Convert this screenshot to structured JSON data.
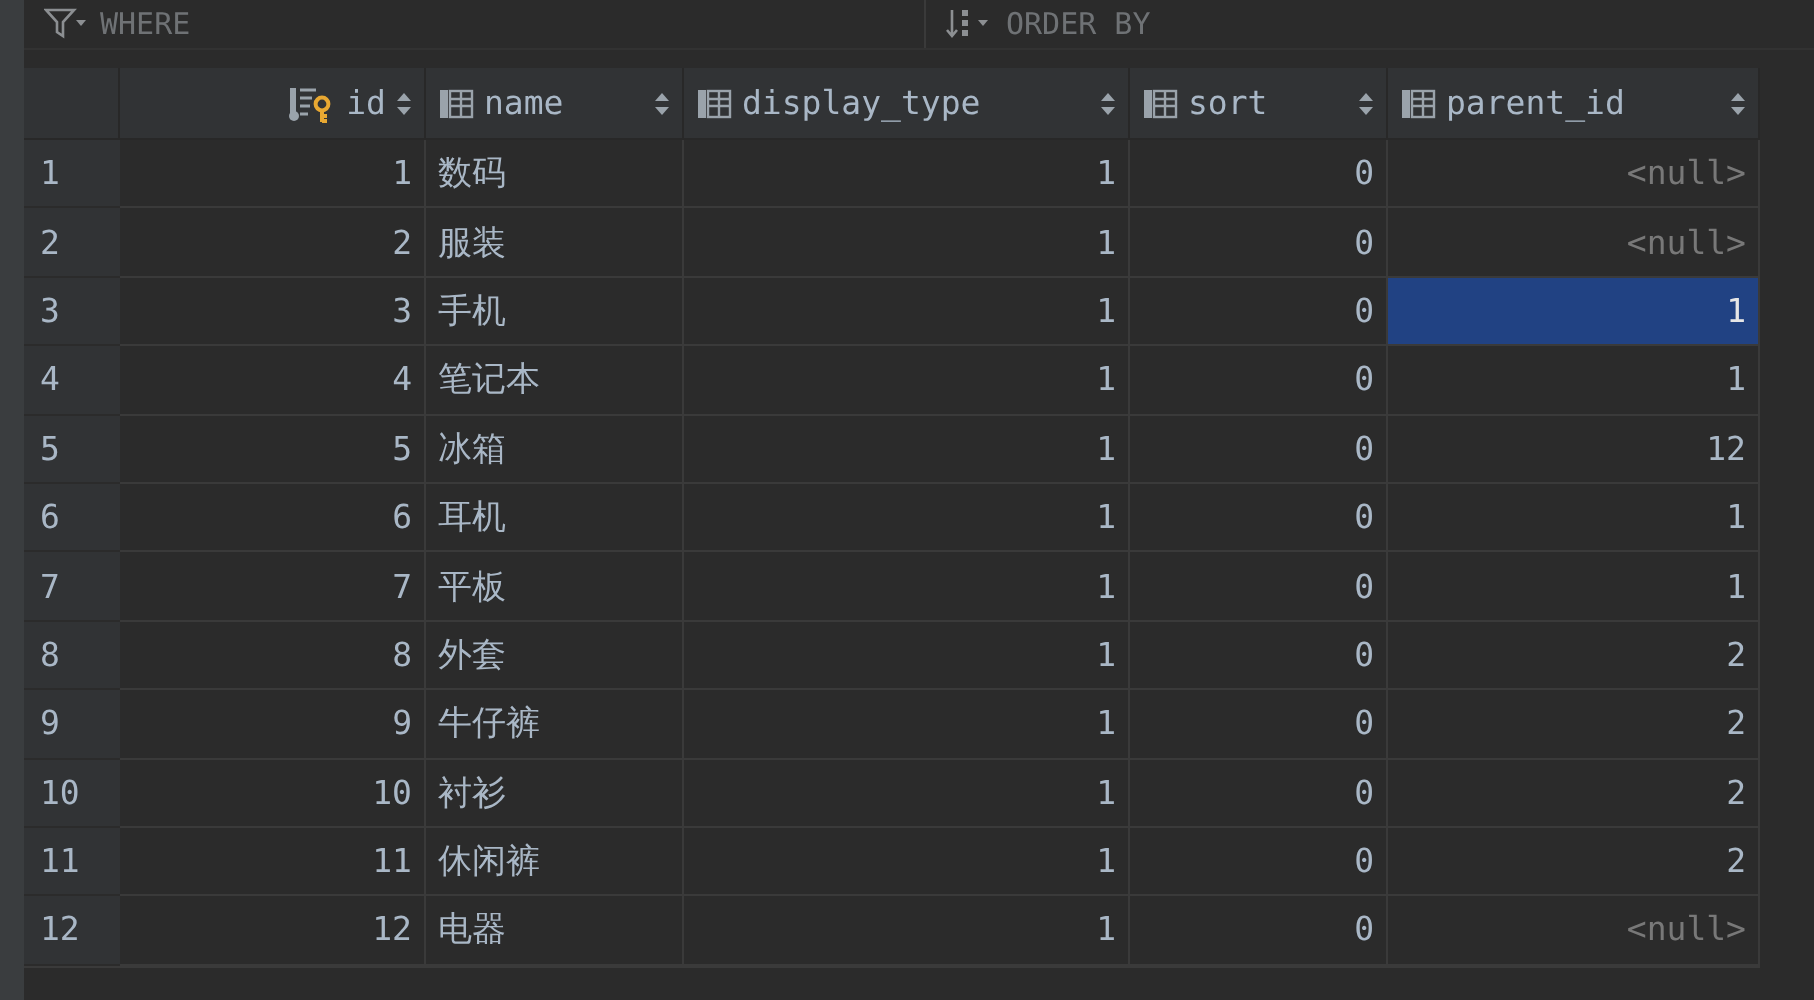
{
  "filter_bar": {
    "where": {
      "placeholder": "WHERE"
    },
    "order_by": {
      "placeholder": "ORDER BY"
    }
  },
  "table": {
    "columns": [
      {
        "label": "id",
        "kind": "key"
      },
      {
        "label": "name",
        "kind": "column"
      },
      {
        "label": "display_type",
        "kind": "column"
      },
      {
        "label": "sort",
        "kind": "column"
      },
      {
        "label": "parent_id",
        "kind": "column"
      }
    ],
    "rows": [
      {
        "number": "1",
        "cells": [
          {
            "value": "1",
            "kind": "number",
            "selected": false
          },
          {
            "value": "数码",
            "kind": "text",
            "selected": false
          },
          {
            "value": "1",
            "kind": "number",
            "selected": false
          },
          {
            "value": "0",
            "kind": "number",
            "selected": false
          },
          {
            "value": "<null>",
            "kind": "null",
            "selected": false
          }
        ]
      },
      {
        "number": "2",
        "cells": [
          {
            "value": "2",
            "kind": "number",
            "selected": false
          },
          {
            "value": "服装",
            "kind": "text",
            "selected": false
          },
          {
            "value": "1",
            "kind": "number",
            "selected": false
          },
          {
            "value": "0",
            "kind": "number",
            "selected": false
          },
          {
            "value": "<null>",
            "kind": "null",
            "selected": false
          }
        ]
      },
      {
        "number": "3",
        "cells": [
          {
            "value": "3",
            "kind": "number",
            "selected": false
          },
          {
            "value": "手机",
            "kind": "text",
            "selected": false
          },
          {
            "value": "1",
            "kind": "number",
            "selected": false
          },
          {
            "value": "0",
            "kind": "number",
            "selected": false
          },
          {
            "value": "1",
            "kind": "number",
            "selected": true
          }
        ]
      },
      {
        "number": "4",
        "cells": [
          {
            "value": "4",
            "kind": "number",
            "selected": false
          },
          {
            "value": "笔记本",
            "kind": "text",
            "selected": false
          },
          {
            "value": "1",
            "kind": "number",
            "selected": false
          },
          {
            "value": "0",
            "kind": "number",
            "selected": false
          },
          {
            "value": "1",
            "kind": "number",
            "selected": false
          }
        ]
      },
      {
        "number": "5",
        "cells": [
          {
            "value": "5",
            "kind": "number",
            "selected": false
          },
          {
            "value": "冰箱",
            "kind": "text",
            "selected": false
          },
          {
            "value": "1",
            "kind": "number",
            "selected": false
          },
          {
            "value": "0",
            "kind": "number",
            "selected": false
          },
          {
            "value": "12",
            "kind": "number",
            "selected": false
          }
        ]
      },
      {
        "number": "6",
        "cells": [
          {
            "value": "6",
            "kind": "number",
            "selected": false
          },
          {
            "value": "耳机",
            "kind": "text",
            "selected": false
          },
          {
            "value": "1",
            "kind": "number",
            "selected": false
          },
          {
            "value": "0",
            "kind": "number",
            "selected": false
          },
          {
            "value": "1",
            "kind": "number",
            "selected": false
          }
        ]
      },
      {
        "number": "7",
        "cells": [
          {
            "value": "7",
            "kind": "number",
            "selected": false
          },
          {
            "value": "平板",
            "kind": "text",
            "selected": false
          },
          {
            "value": "1",
            "kind": "number",
            "selected": false
          },
          {
            "value": "0",
            "kind": "number",
            "selected": false
          },
          {
            "value": "1",
            "kind": "number",
            "selected": false
          }
        ]
      },
      {
        "number": "8",
        "cells": [
          {
            "value": "8",
            "kind": "number",
            "selected": false
          },
          {
            "value": "外套",
            "kind": "text",
            "selected": false
          },
          {
            "value": "1",
            "kind": "number",
            "selected": false
          },
          {
            "value": "0",
            "kind": "number",
            "selected": false
          },
          {
            "value": "2",
            "kind": "number",
            "selected": false
          }
        ]
      },
      {
        "number": "9",
        "cells": [
          {
            "value": "9",
            "kind": "number",
            "selected": false
          },
          {
            "value": "牛仔裤",
            "kind": "text",
            "selected": false
          },
          {
            "value": "1",
            "kind": "number",
            "selected": false
          },
          {
            "value": "0",
            "kind": "number",
            "selected": false
          },
          {
            "value": "2",
            "kind": "number",
            "selected": false
          }
        ]
      },
      {
        "number": "10",
        "cells": [
          {
            "value": "10",
            "kind": "number",
            "selected": false
          },
          {
            "value": "衬衫",
            "kind": "text",
            "selected": false
          },
          {
            "value": "1",
            "kind": "number",
            "selected": false
          },
          {
            "value": "0",
            "kind": "number",
            "selected": false
          },
          {
            "value": "2",
            "kind": "number",
            "selected": false
          }
        ]
      },
      {
        "number": "11",
        "cells": [
          {
            "value": "11",
            "kind": "number",
            "selected": false
          },
          {
            "value": "休闲裤",
            "kind": "text",
            "selected": false
          },
          {
            "value": "1",
            "kind": "number",
            "selected": false
          },
          {
            "value": "0",
            "kind": "number",
            "selected": false
          },
          {
            "value": "2",
            "kind": "number",
            "selected": false
          }
        ]
      },
      {
        "number": "12",
        "cells": [
          {
            "value": "12",
            "kind": "number",
            "selected": false
          },
          {
            "value": "电器",
            "kind": "text",
            "selected": false
          },
          {
            "value": "1",
            "kind": "number",
            "selected": false
          },
          {
            "value": "0",
            "kind": "number",
            "selected": false
          },
          {
            "value": "<null>",
            "kind": "null",
            "selected": false
          }
        ]
      }
    ]
  }
}
